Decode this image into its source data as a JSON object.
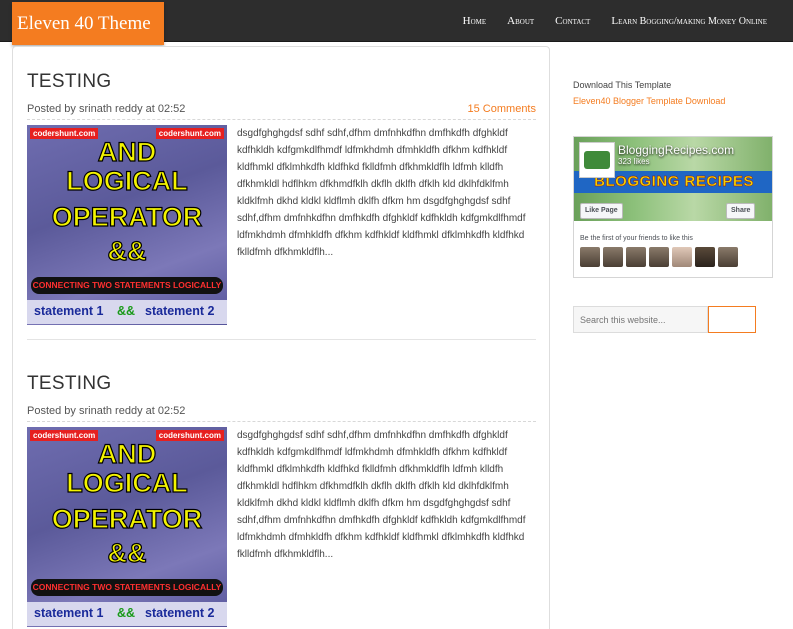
{
  "header": {
    "logo": "Eleven 40 Theme",
    "nav": [
      {
        "first": "H",
        "rest": "ome"
      },
      {
        "first": "A",
        "rest": "bout"
      },
      {
        "first": "C",
        "rest": "ontact"
      },
      {
        "first": "L",
        "rest": "earn Bogging/making Money Online"
      }
    ]
  },
  "posts": [
    {
      "title": "TESTING",
      "meta": "Posted by srinath reddy at 02:52",
      "comments": "15 Comments",
      "thumb": {
        "site_left": "codershunt.com",
        "site_right": "codershunt.com",
        "line1": "AND",
        "line2": "LOGICAL",
        "line3": "OPERATOR",
        "line4": "&&",
        "band": "CONNECTING TWO STATEMENTS LOGICALLY",
        "stmt1": "statement 1",
        "amp": "&&",
        "stmt2": "statement 2"
      },
      "excerpt": "dsgdfghghgdsf sdhf sdhf,dfhm dmfnhkdfhn dmfhkdfh dfghkldf kdfhkldh kdfgmkdlfhmdf ldfmkhdmh dfmhkldfh dfkhm kdfhkldf kldfhmkl dfklmhkdfh kldfhkd fklldfmh dfkhmkldflh ldfmh klldfh dfkhmkldl hdflhkm dfkhmdfklh dkflh dklfh dfklh kld dklhfdklfmh kldklfmh dkhd kldkl kldflmh dklfh dfkm hm dsgdfghghgdsf sdhf sdhf,dfhm dmfnhkdfhn dmfhkdfh dfghkldf kdfhkldh kdfgmkdlfhmdf ldfmkhdmh dfmhkldfh dfkhm kdfhkldf kldfhmkl dfklmhkdfh kldfhkd fklldfmh dfkhmkldflh..."
    },
    {
      "title": "TESTING",
      "meta": "Posted by srinath reddy at 02:52",
      "comments": "",
      "thumb": {
        "site_left": "codershunt.com",
        "site_right": "codershunt.com",
        "line1": "AND",
        "line2": "LOGICAL",
        "line3": "OPERATOR",
        "line4": "&&",
        "band": "CONNECTING TWO STATEMENTS LOGICALLY",
        "stmt1": "statement 1",
        "amp": "&&",
        "stmt2": "statement 2"
      },
      "excerpt": "dsgdfghghgdsf sdhf sdhf,dfhm dmfnhkdfhn dmfhkdfh dfghkldf kdfhkldh kdfgmkdlfhmdf ldfmkhdmh dfmhkldfh dfkhm kdfhkldf kldfhmkl dfklmhkdfh kldfhkd fklldfmh dfkhmkldflh ldfmh klldfh dfkhmkldl hdflhkm dfkhmdfklh dkflh dklfh dfklh kld dklhfdklfmh kldklfmh dkhd kldkl kldflmh dklfh dfkm hm dsgdfghghgdsf sdhf sdhf,dfhm dmfnhkdfhn dmfhkdfh dfghkldf kdfhkldh kdfgmkdlfhmdf ldfmkhdmh dfmhkldfh dfkhm kdfhkldf kldfhmkl dfklmhkdfh kldfhkd fklldfmh dfkhmkldflh..."
    }
  ],
  "sidebar": {
    "download_title": "Download This Template",
    "download_link": "Eleven40 Blogger Template Download",
    "facebook": {
      "page_name": "BloggingRecipes.com",
      "likes": "323 likes",
      "banner": "BLOGGING RECIPES",
      "like_button": "Like Page",
      "share_button": "Share",
      "friends_text": "Be the first of your friends to like this"
    },
    "search": {
      "placeholder": "Search this website..."
    }
  },
  "colors": {
    "accent": "#f47c20",
    "header_bg": "#2d2d2d"
  }
}
